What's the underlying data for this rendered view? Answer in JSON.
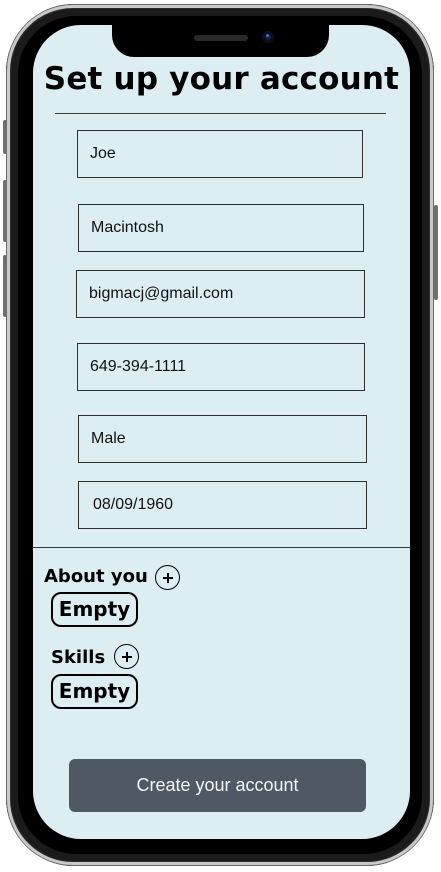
{
  "page": {
    "title": "Set up your account"
  },
  "form": {
    "first_name": "Joe",
    "last_name": "Macintosh",
    "email": "bigmacj@gmail.com",
    "phone": "649-394-1111",
    "gender": "Male",
    "birthdate": "08/09/1960"
  },
  "about": {
    "label": "About you",
    "value": "Empty",
    "add_icon": "plus-icon"
  },
  "skills": {
    "label": "Skills",
    "value": "Empty",
    "add_icon": "plus-icon"
  },
  "actions": {
    "create_label": "Create your account"
  },
  "colors": {
    "screen_bg": "#ddeef2",
    "button_bg": "#4e5963",
    "button_text": "#f2f4f6"
  }
}
